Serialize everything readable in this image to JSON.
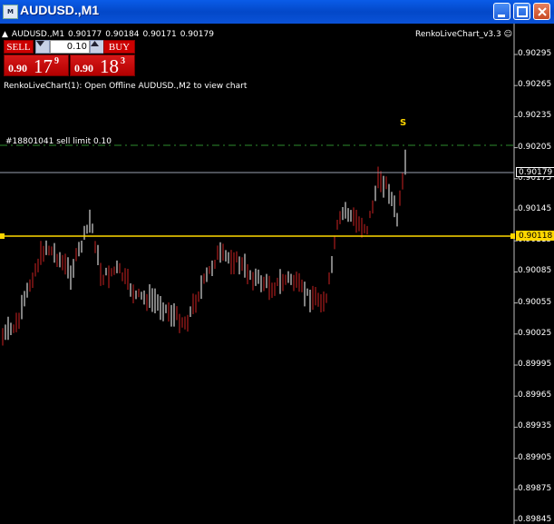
{
  "window": {
    "title": "AUDUSD.,M1",
    "icon_label": "M"
  },
  "chart": {
    "symbol_line": [
      "AUDUSD.,M1",
      "0.90177",
      "0.90184",
      "0.90171",
      "0.90179"
    ],
    "indicator_name": "RenkoLiveChart_v3.3",
    "message": "RenkoLiveChart(1): Open Offline AUDUSD.,M2 to view chart",
    "order_label": "#18801041 sell limit 0.10",
    "signal_marker": "S",
    "colors": {
      "bid_line": "#9aa0b0",
      "order_line": "#2e8b2e",
      "yellow_line": "#ffd700",
      "bull": "#ffffff",
      "bear": "#cc2222"
    },
    "current_price_tag": "0.90179",
    "yellow_line_tag": "0.90118",
    "y_axis_labels": [
      "0.90295",
      "0.90265",
      "0.90235",
      "0.90205",
      "0.90175",
      "0.90145",
      "0.90115",
      "0.90085",
      "0.90055",
      "0.90025",
      "0.89995",
      "0.89965",
      "0.89935",
      "0.89905",
      "0.89875",
      "0.89845"
    ]
  },
  "trade_panel": {
    "sell_label": "SELL",
    "buy_label": "BUY",
    "lot": "0.10",
    "sell_price": {
      "small": "0.90",
      "big": "17",
      "pip": "9"
    },
    "buy_price": {
      "small": "0.90",
      "big": "18",
      "pip": "3"
    }
  }
}
